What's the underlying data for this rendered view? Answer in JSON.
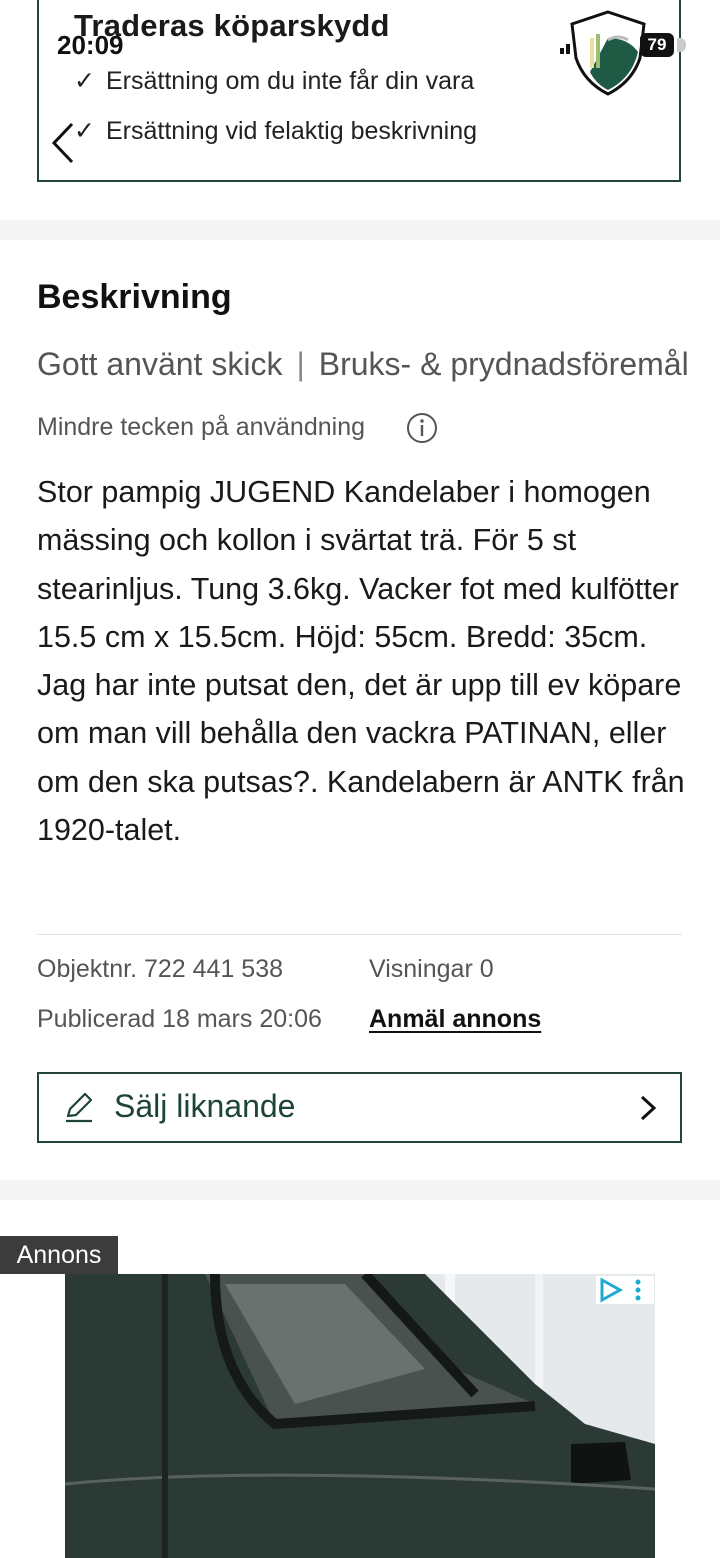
{
  "status_bar": {
    "time": "20:09",
    "battery": "79"
  },
  "protection": {
    "title": "Traderas köparskydd",
    "items": [
      "Ersättning om du inte får din vara",
      "Ersättning vid felaktig beskrivning"
    ]
  },
  "description": {
    "heading": "Beskrivning",
    "condition": "Gott använt skick",
    "category": "Bruks- & prydnadsföremål",
    "condition_detail": "Mindre tecken på användning",
    "text": "Stor pampig JUGEND Kandelaber i homogen mässing och kollon i svärtat trä. För 5 st stearinljus. Tung 3.6kg. Vacker fot med kulfötter 15.5 cm x 15.5cm. Höjd: 55cm. Bredd: 35cm. Jag har inte putsat den, det är upp till ev köpare om man vill behålla den vackra PATINAN, eller om den ska putsas?. Kandelabern är ANTK från 1920-talet."
  },
  "meta": {
    "object_no": "Objektnr. 722 441 538",
    "views": "Visningar 0",
    "published": "Publicerad 18 mars 20:06",
    "report": "Anmäl annons"
  },
  "sell_similar": {
    "label": "Sälj liknande"
  },
  "ad": {
    "label": "Annons"
  },
  "colors": {
    "brand_green": "#24453a",
    "text": "#1a1a1a",
    "muted": "#555555"
  }
}
